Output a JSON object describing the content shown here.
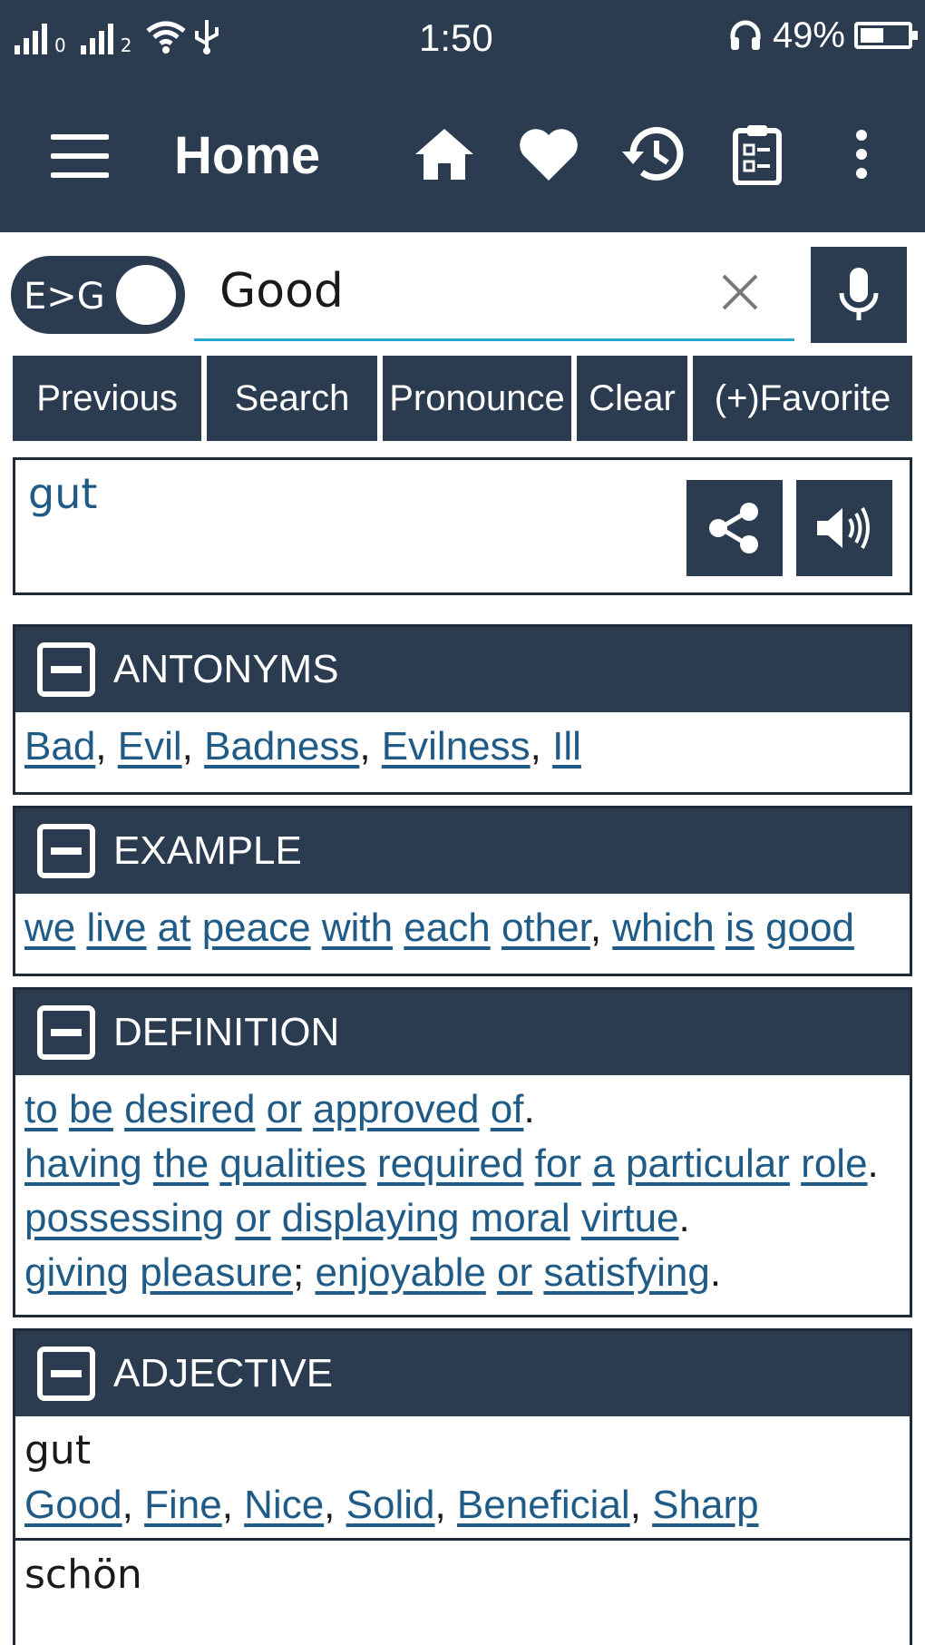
{
  "status_bar": {
    "sim1_label": "0",
    "sim2_label": "2",
    "time": "1:50",
    "battery_percent": "49%",
    "battery_level": 0.49
  },
  "app_bar": {
    "title": "Home",
    "icons": [
      "menu-icon",
      "home-icon",
      "heart-icon",
      "history-icon",
      "clipboard-icon",
      "more-vert-icon"
    ]
  },
  "search": {
    "direction_label": "E>G",
    "query": "Good"
  },
  "actions": {
    "previous": "Previous",
    "search": "Search",
    "pronounce": "Pronounce",
    "clear": "Clear",
    "favorite": "(+)Favorite"
  },
  "result": {
    "translation": "gut"
  },
  "sections": {
    "antonyms": {
      "title": "ANTONYMS",
      "items": [
        "Bad",
        "Evil",
        "Badness",
        "Evilness",
        "Ill"
      ]
    },
    "example": {
      "title": "EXAMPLE",
      "words": [
        "we",
        "live",
        "at",
        "peace",
        "with",
        "each",
        "other",
        "which",
        "is",
        "good"
      ]
    },
    "definition": {
      "title": "DEFINITION",
      "line1": [
        "to",
        "be",
        "desired",
        "or",
        "approved",
        "of"
      ],
      "line2": [
        "having",
        "the",
        "qualities",
        "required",
        "for",
        "a",
        "particular",
        "role"
      ],
      "line3": [
        "possessing",
        "or",
        "displaying",
        "moral",
        "virtue"
      ],
      "line4a": [
        "giving",
        "pleasure"
      ],
      "line4b": [
        "enjoyable",
        "or",
        "satisfying"
      ]
    },
    "adjective": {
      "title": "ADJECTIVE",
      "entries": [
        {
          "word": "gut",
          "synonyms": [
            "Good",
            "Fine",
            "Nice",
            "Solid",
            "Beneficial",
            "Sharp"
          ]
        },
        {
          "word": "schön"
        }
      ]
    }
  },
  "colors": {
    "primary": "#2b3b50",
    "link": "#1f5b86",
    "accent": "#2aa7cf"
  }
}
